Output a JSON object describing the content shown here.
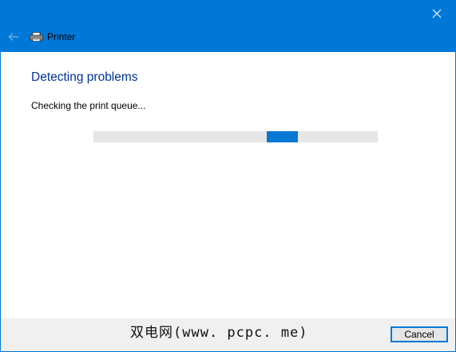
{
  "window": {
    "title": "Printer",
    "close_icon": "close-icon",
    "back_icon": "back-arrow-icon",
    "app_icon": "printer-icon"
  },
  "main": {
    "heading": "Detecting problems",
    "status": "Checking the print queue...",
    "progress": {
      "type": "indeterminate",
      "segment_start_fraction": 0.61,
      "segment_width_fraction": 0.11
    }
  },
  "footer": {
    "watermark": "双电网(www. pcpc. me)",
    "cancel_label": "Cancel"
  },
  "colors": {
    "accent": "#0078d7",
    "heading": "#003399",
    "progress_track": "#e6e6e6",
    "progress_fill": "#0678d4",
    "footer_bg": "#f0f0f0"
  }
}
